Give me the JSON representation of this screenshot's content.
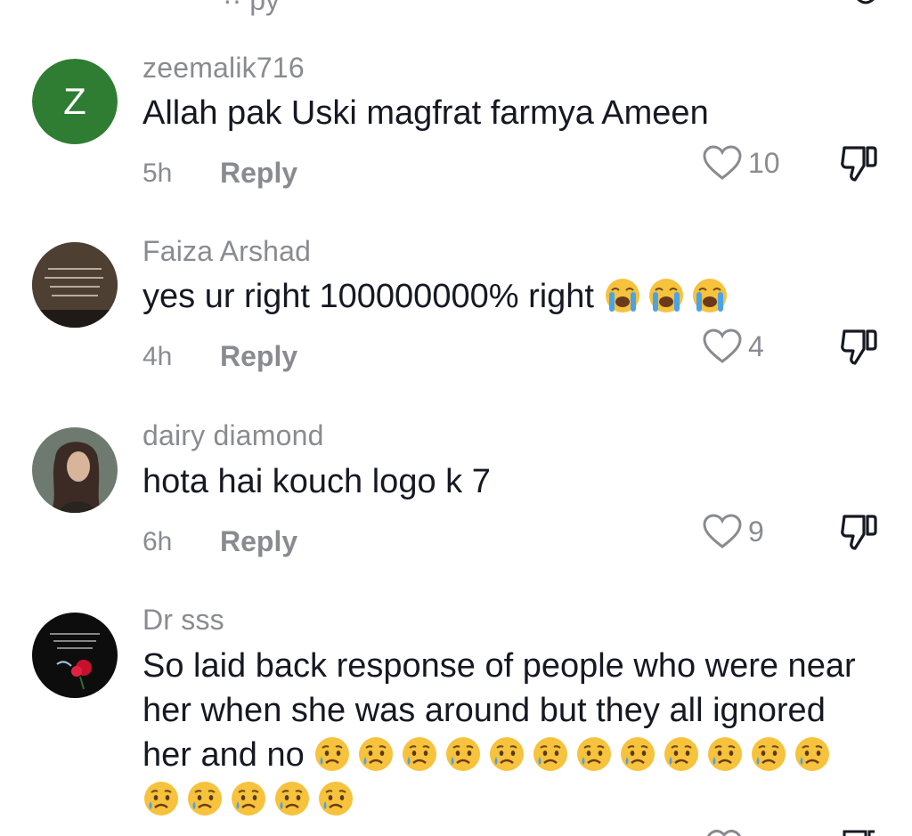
{
  "comments": [
    {
      "username": "zeemalik716",
      "avatar_letter": "Z",
      "avatar_color": "#2f7d32",
      "text": "Allah pak Uski magfrat farmya Ameen",
      "time": "5h",
      "reply_label": "Reply",
      "likes": "10"
    },
    {
      "username": "Faiza Arshad",
      "text": "yes ur right 100000000% right",
      "emojis": [
        "loudly-crying-face",
        "loudly-crying-face",
        "loudly-crying-face"
      ],
      "time": "4h",
      "reply_label": "Reply",
      "likes": "4"
    },
    {
      "username": "dairy diamond",
      "text": "hota hai kouch logo k 7",
      "time": "6h",
      "reply_label": "Reply",
      "likes": "9"
    },
    {
      "username": "Dr sss",
      "text": "So laid back response of people who were near her when she was around but they all ignored her and no",
      "emoji_count": 17,
      "emoji": "crying-face"
    }
  ],
  "colors": {
    "text_primary": "#161823",
    "text_secondary": "#8a8b91",
    "background": "#ffffff"
  },
  "icons": {
    "like": "heart-outline-icon",
    "dislike": "thumbs-down-outline-icon"
  }
}
